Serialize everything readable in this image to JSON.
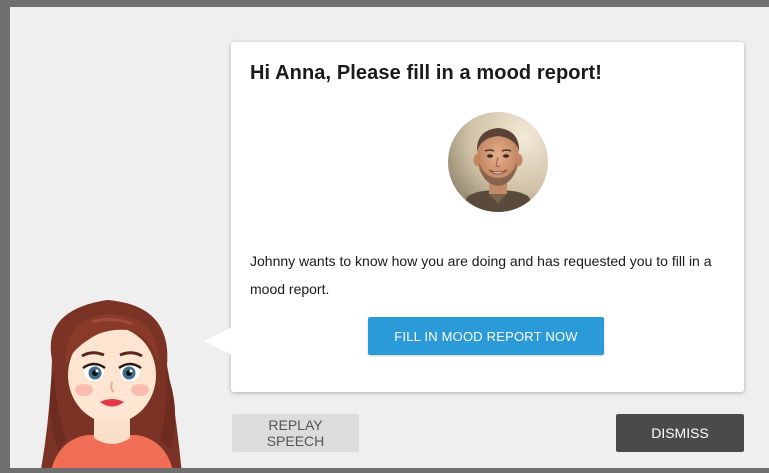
{
  "notification": {
    "title": "Hi Anna, Please fill in a mood report!",
    "message": "Johnny wants to know how you are doing and has requested you to fill in a mood report.",
    "primary_button": "FILL IN MOOD REPORT NOW"
  },
  "footer": {
    "replay_label": "REPLAY SPEECH",
    "dismiss_label": "DISMISS"
  },
  "colors": {
    "primary": "#2a9ad9",
    "dismiss": "#4a4a4a",
    "replay": "#dcdcdc",
    "background": "#efefef",
    "frame": "#707070"
  },
  "icons": {
    "sender_avatar": "avatar-photo",
    "assistant_character": "cartoon-woman"
  }
}
